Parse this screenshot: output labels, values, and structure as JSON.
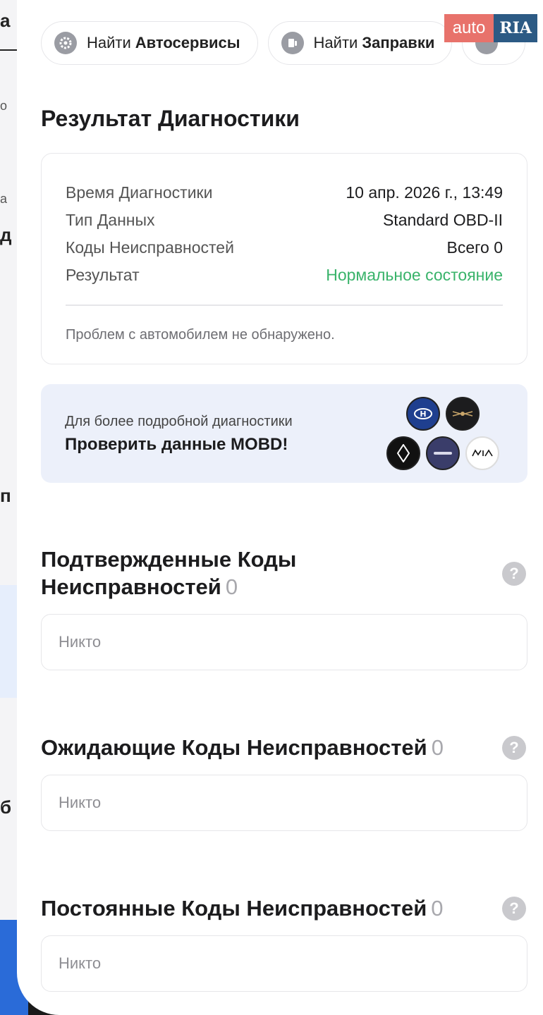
{
  "chips": [
    {
      "prefix": "Найти",
      "bold": "Автосервисы",
      "icon": "gear-icon"
    },
    {
      "prefix": "Найти",
      "bold": "Заправки",
      "icon": "fuel-icon"
    }
  ],
  "logo": {
    "auto": "auto",
    "ria": "RIA"
  },
  "diagnostics": {
    "title": "Результат Диагностики",
    "rows": [
      {
        "label": "Время Диагностики",
        "value": "10 апр. 2026 г., 13:49"
      },
      {
        "label": "Тип Данных",
        "value": "Standard OBD-II"
      },
      {
        "label": "Коды Неисправностей",
        "value": "Всего 0"
      },
      {
        "label": "Результат",
        "value": "Нормальное состояние"
      }
    ],
    "note": "Проблем с автомобилем не обнаружено.",
    "status_color": "#39b36a"
  },
  "mobd": {
    "subtitle": "Для более подробной диагностики",
    "cta": "Проверить данные MOBD!",
    "brands": [
      "hyundai-logo",
      "genesis-logo",
      "renault-logo",
      "kgm-logo",
      "kia-logo"
    ]
  },
  "sections": [
    {
      "title_line1": "Подтвержденные Коды",
      "title_line2": "Неисправностей",
      "count": "0",
      "empty": "Никто"
    },
    {
      "title": "Ожидающие Коды Неисправностей",
      "count": "0",
      "empty": "Никто"
    },
    {
      "title": "Постоянные Коды Неисправностей",
      "count": "0",
      "empty": "Никто"
    }
  ]
}
